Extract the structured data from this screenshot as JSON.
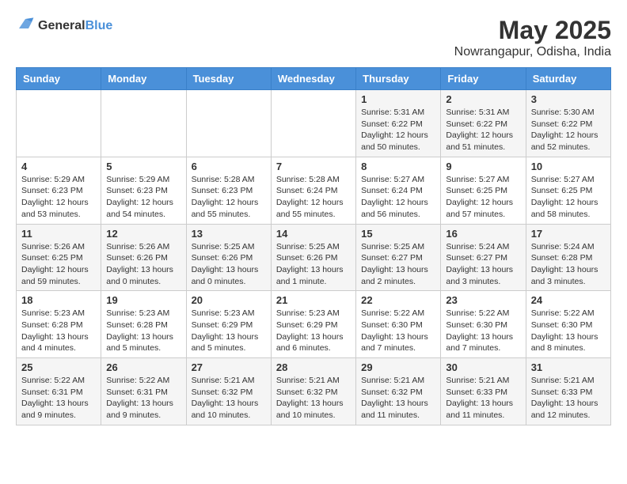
{
  "header": {
    "logo_general": "General",
    "logo_blue": "Blue",
    "month": "May 2025",
    "location": "Nowrangapur, Odisha, India"
  },
  "days_of_week": [
    "Sunday",
    "Monday",
    "Tuesday",
    "Wednesday",
    "Thursday",
    "Friday",
    "Saturday"
  ],
  "weeks": [
    [
      {
        "day": "",
        "info": ""
      },
      {
        "day": "",
        "info": ""
      },
      {
        "day": "",
        "info": ""
      },
      {
        "day": "",
        "info": ""
      },
      {
        "day": "1",
        "info": "Sunrise: 5:31 AM\nSunset: 6:22 PM\nDaylight: 12 hours\nand 50 minutes."
      },
      {
        "day": "2",
        "info": "Sunrise: 5:31 AM\nSunset: 6:22 PM\nDaylight: 12 hours\nand 51 minutes."
      },
      {
        "day": "3",
        "info": "Sunrise: 5:30 AM\nSunset: 6:22 PM\nDaylight: 12 hours\nand 52 minutes."
      }
    ],
    [
      {
        "day": "4",
        "info": "Sunrise: 5:29 AM\nSunset: 6:23 PM\nDaylight: 12 hours\nand 53 minutes."
      },
      {
        "day": "5",
        "info": "Sunrise: 5:29 AM\nSunset: 6:23 PM\nDaylight: 12 hours\nand 54 minutes."
      },
      {
        "day": "6",
        "info": "Sunrise: 5:28 AM\nSunset: 6:23 PM\nDaylight: 12 hours\nand 55 minutes."
      },
      {
        "day": "7",
        "info": "Sunrise: 5:28 AM\nSunset: 6:24 PM\nDaylight: 12 hours\nand 55 minutes."
      },
      {
        "day": "8",
        "info": "Sunrise: 5:27 AM\nSunset: 6:24 PM\nDaylight: 12 hours\nand 56 minutes."
      },
      {
        "day": "9",
        "info": "Sunrise: 5:27 AM\nSunset: 6:25 PM\nDaylight: 12 hours\nand 57 minutes."
      },
      {
        "day": "10",
        "info": "Sunrise: 5:27 AM\nSunset: 6:25 PM\nDaylight: 12 hours\nand 58 minutes."
      }
    ],
    [
      {
        "day": "11",
        "info": "Sunrise: 5:26 AM\nSunset: 6:25 PM\nDaylight: 12 hours\nand 59 minutes."
      },
      {
        "day": "12",
        "info": "Sunrise: 5:26 AM\nSunset: 6:26 PM\nDaylight: 13 hours\nand 0 minutes."
      },
      {
        "day": "13",
        "info": "Sunrise: 5:25 AM\nSunset: 6:26 PM\nDaylight: 13 hours\nand 0 minutes."
      },
      {
        "day": "14",
        "info": "Sunrise: 5:25 AM\nSunset: 6:26 PM\nDaylight: 13 hours\nand 1 minute."
      },
      {
        "day": "15",
        "info": "Sunrise: 5:25 AM\nSunset: 6:27 PM\nDaylight: 13 hours\nand 2 minutes."
      },
      {
        "day": "16",
        "info": "Sunrise: 5:24 AM\nSunset: 6:27 PM\nDaylight: 13 hours\nand 3 minutes."
      },
      {
        "day": "17",
        "info": "Sunrise: 5:24 AM\nSunset: 6:28 PM\nDaylight: 13 hours\nand 3 minutes."
      }
    ],
    [
      {
        "day": "18",
        "info": "Sunrise: 5:23 AM\nSunset: 6:28 PM\nDaylight: 13 hours\nand 4 minutes."
      },
      {
        "day": "19",
        "info": "Sunrise: 5:23 AM\nSunset: 6:28 PM\nDaylight: 13 hours\nand 5 minutes."
      },
      {
        "day": "20",
        "info": "Sunrise: 5:23 AM\nSunset: 6:29 PM\nDaylight: 13 hours\nand 5 minutes."
      },
      {
        "day": "21",
        "info": "Sunrise: 5:23 AM\nSunset: 6:29 PM\nDaylight: 13 hours\nand 6 minutes."
      },
      {
        "day": "22",
        "info": "Sunrise: 5:22 AM\nSunset: 6:30 PM\nDaylight: 13 hours\nand 7 minutes."
      },
      {
        "day": "23",
        "info": "Sunrise: 5:22 AM\nSunset: 6:30 PM\nDaylight: 13 hours\nand 7 minutes."
      },
      {
        "day": "24",
        "info": "Sunrise: 5:22 AM\nSunset: 6:30 PM\nDaylight: 13 hours\nand 8 minutes."
      }
    ],
    [
      {
        "day": "25",
        "info": "Sunrise: 5:22 AM\nSunset: 6:31 PM\nDaylight: 13 hours\nand 9 minutes."
      },
      {
        "day": "26",
        "info": "Sunrise: 5:22 AM\nSunset: 6:31 PM\nDaylight: 13 hours\nand 9 minutes."
      },
      {
        "day": "27",
        "info": "Sunrise: 5:21 AM\nSunset: 6:32 PM\nDaylight: 13 hours\nand 10 minutes."
      },
      {
        "day": "28",
        "info": "Sunrise: 5:21 AM\nSunset: 6:32 PM\nDaylight: 13 hours\nand 10 minutes."
      },
      {
        "day": "29",
        "info": "Sunrise: 5:21 AM\nSunset: 6:32 PM\nDaylight: 13 hours\nand 11 minutes."
      },
      {
        "day": "30",
        "info": "Sunrise: 5:21 AM\nSunset: 6:33 PM\nDaylight: 13 hours\nand 11 minutes."
      },
      {
        "day": "31",
        "info": "Sunrise: 5:21 AM\nSunset: 6:33 PM\nDaylight: 13 hours\nand 12 minutes."
      }
    ]
  ]
}
